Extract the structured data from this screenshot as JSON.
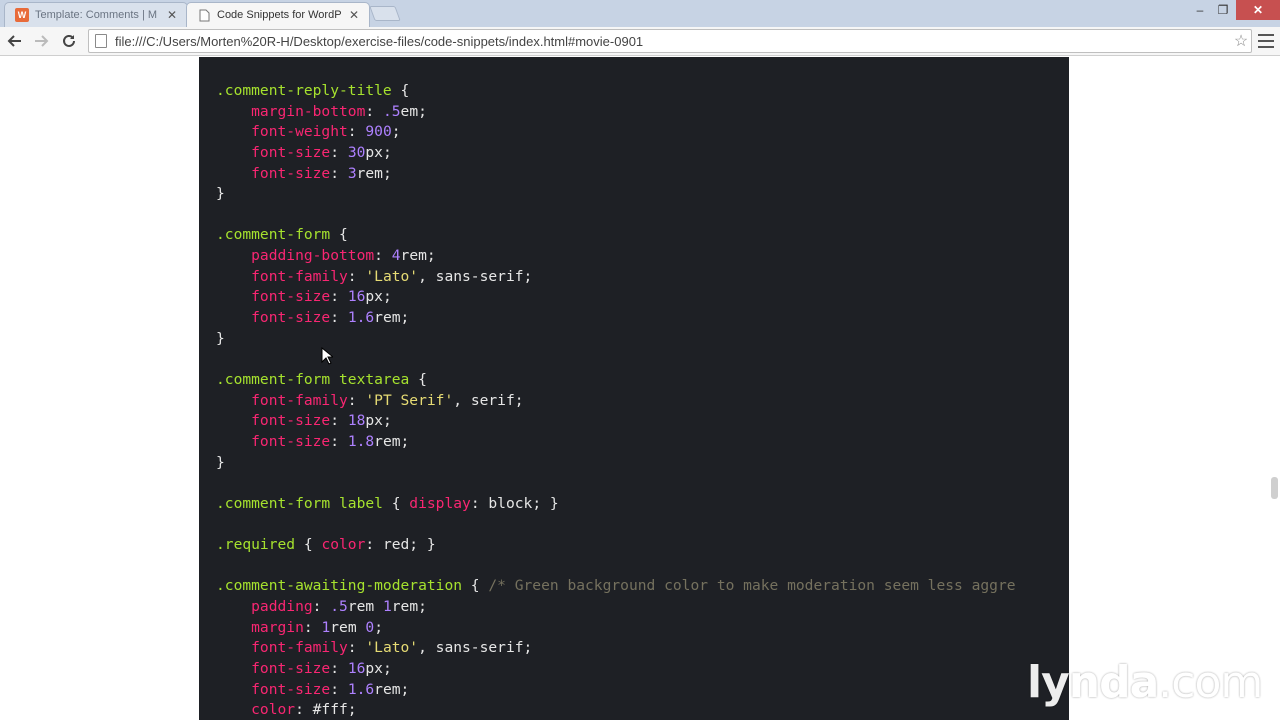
{
  "browser": {
    "tabs": [
      {
        "title": "Template: Comments | M",
        "active": false
      },
      {
        "title": "Code Snippets for WordP",
        "active": true
      }
    ],
    "url": "file:///C:/Users/Morten%20R-H/Desktop/exercise-files/code-snippets/index.html#movie-0901",
    "window_controls": {
      "minimize": "–",
      "maximize": "❐",
      "close": "✕"
    }
  },
  "icons": {
    "back": "back-arrow-icon",
    "forward": "forward-arrow-icon",
    "reload": "reload-icon",
    "bookmark": "star-icon",
    "menu": "hamburger-menu-icon"
  },
  "code_lines": [
    [
      {
        "t": ".comment-reply-title",
        "c": "sel"
      },
      {
        "t": " {",
        "c": "val"
      }
    ],
    [
      {
        "t": "    margin-bottom",
        "c": "prop"
      },
      {
        "t": ": ",
        "c": "val"
      },
      {
        "t": ".5",
        "c": "num"
      },
      {
        "t": "em;",
        "c": "val"
      }
    ],
    [
      {
        "t": "    font-weight",
        "c": "prop"
      },
      {
        "t": ": ",
        "c": "val"
      },
      {
        "t": "900",
        "c": "num"
      },
      {
        "t": ";",
        "c": "val"
      }
    ],
    [
      {
        "t": "    font-size",
        "c": "prop"
      },
      {
        "t": ": ",
        "c": "val"
      },
      {
        "t": "30",
        "c": "num"
      },
      {
        "t": "px;",
        "c": "val"
      }
    ],
    [
      {
        "t": "    font-size",
        "c": "prop"
      },
      {
        "t": ": ",
        "c": "val"
      },
      {
        "t": "3",
        "c": "num"
      },
      {
        "t": "rem;",
        "c": "val"
      }
    ],
    [
      {
        "t": "}",
        "c": "val"
      }
    ],
    [],
    [
      {
        "t": ".comment-form",
        "c": "sel"
      },
      {
        "t": " {",
        "c": "val"
      }
    ],
    [
      {
        "t": "    padding-bottom",
        "c": "prop"
      },
      {
        "t": ": ",
        "c": "val"
      },
      {
        "t": "4",
        "c": "num"
      },
      {
        "t": "rem;",
        "c": "val"
      }
    ],
    [
      {
        "t": "    font-family",
        "c": "prop"
      },
      {
        "t": ": ",
        "c": "val"
      },
      {
        "t": "'Lato'",
        "c": "str"
      },
      {
        "t": ", sans-serif;",
        "c": "val"
      }
    ],
    [
      {
        "t": "    font-size",
        "c": "prop"
      },
      {
        "t": ": ",
        "c": "val"
      },
      {
        "t": "16",
        "c": "num"
      },
      {
        "t": "px;",
        "c": "val"
      }
    ],
    [
      {
        "t": "    font-size",
        "c": "prop"
      },
      {
        "t": ": ",
        "c": "val"
      },
      {
        "t": "1.6",
        "c": "num"
      },
      {
        "t": "rem;",
        "c": "val"
      }
    ],
    [
      {
        "t": "}",
        "c": "val"
      }
    ],
    [],
    [
      {
        "t": ".comment-form textarea",
        "c": "sel"
      },
      {
        "t": " {",
        "c": "val"
      }
    ],
    [
      {
        "t": "    font-family",
        "c": "prop"
      },
      {
        "t": ": ",
        "c": "val"
      },
      {
        "t": "'PT Serif'",
        "c": "str"
      },
      {
        "t": ", serif;",
        "c": "val"
      }
    ],
    [
      {
        "t": "    font-size",
        "c": "prop"
      },
      {
        "t": ": ",
        "c": "val"
      },
      {
        "t": "18",
        "c": "num"
      },
      {
        "t": "px;",
        "c": "val"
      }
    ],
    [
      {
        "t": "    font-size",
        "c": "prop"
      },
      {
        "t": ": ",
        "c": "val"
      },
      {
        "t": "1.8",
        "c": "num"
      },
      {
        "t": "rem;",
        "c": "val"
      }
    ],
    [
      {
        "t": "}",
        "c": "val"
      }
    ],
    [],
    [
      {
        "t": ".comment-form label",
        "c": "sel"
      },
      {
        "t": " { ",
        "c": "val"
      },
      {
        "t": "display",
        "c": "prop"
      },
      {
        "t": ": block; }",
        "c": "val"
      }
    ],
    [],
    [
      {
        "t": ".required",
        "c": "sel"
      },
      {
        "t": " { ",
        "c": "val"
      },
      {
        "t": "color",
        "c": "prop"
      },
      {
        "t": ": red; }",
        "c": "val"
      }
    ],
    [],
    [
      {
        "t": ".comment-awaiting-moderation",
        "c": "sel"
      },
      {
        "t": " { ",
        "c": "val"
      },
      {
        "t": "/* Green background color to make moderation seem less aggre",
        "c": "cmt"
      }
    ],
    [
      {
        "t": "    padding",
        "c": "prop"
      },
      {
        "t": ": ",
        "c": "val"
      },
      {
        "t": ".5",
        "c": "num"
      },
      {
        "t": "rem ",
        "c": "val"
      },
      {
        "t": "1",
        "c": "num"
      },
      {
        "t": "rem;",
        "c": "val"
      }
    ],
    [
      {
        "t": "    margin",
        "c": "prop"
      },
      {
        "t": ": ",
        "c": "val"
      },
      {
        "t": "1",
        "c": "num"
      },
      {
        "t": "rem ",
        "c": "val"
      },
      {
        "t": "0",
        "c": "num"
      },
      {
        "t": ";",
        "c": "val"
      }
    ],
    [
      {
        "t": "    font-family",
        "c": "prop"
      },
      {
        "t": ": ",
        "c": "val"
      },
      {
        "t": "'Lato'",
        "c": "str"
      },
      {
        "t": ", sans-serif;",
        "c": "val"
      }
    ],
    [
      {
        "t": "    font-size",
        "c": "prop"
      },
      {
        "t": ": ",
        "c": "val"
      },
      {
        "t": "16",
        "c": "num"
      },
      {
        "t": "px;",
        "c": "val"
      }
    ],
    [
      {
        "t": "    font-size",
        "c": "prop"
      },
      {
        "t": ": ",
        "c": "val"
      },
      {
        "t": "1.6",
        "c": "num"
      },
      {
        "t": "rem;",
        "c": "val"
      }
    ],
    [
      {
        "t": "    color",
        "c": "prop"
      },
      {
        "t": ": #fff;",
        "c": "val"
      }
    ]
  ],
  "watermark": {
    "brand": "lynda",
    "suffix": ".com"
  },
  "colors": {
    "code_background": "#1e2025",
    "selector": "#a6e22e",
    "property": "#f92672",
    "number": "#ae81ff",
    "string": "#e6db74",
    "comment": "#75715e"
  }
}
